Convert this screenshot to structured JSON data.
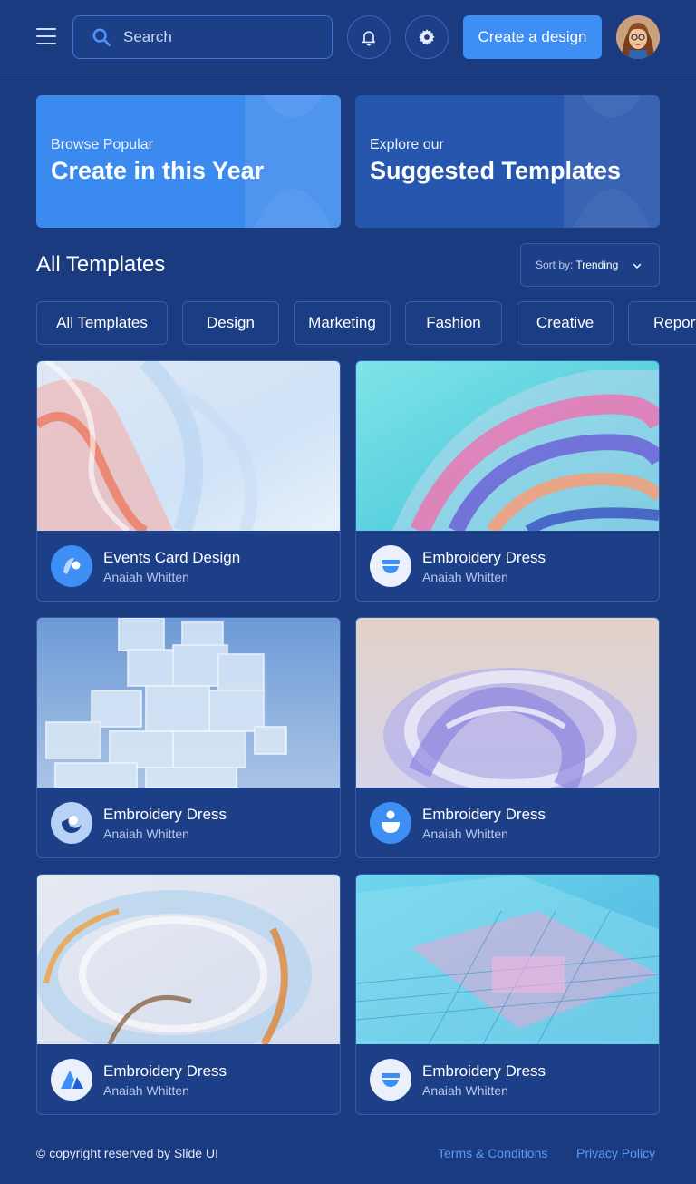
{
  "header": {
    "search_placeholder": "Search",
    "create_label": "Create a design",
    "icons": [
      "menu-icon",
      "search-icon",
      "bell-icon",
      "gear-icon"
    ]
  },
  "hero": [
    {
      "kicker": "Browse Popular",
      "title": "Create in this Year"
    },
    {
      "kicker": "Explore our",
      "title": "Suggested Templates"
    }
  ],
  "section": {
    "title": "All Templates",
    "sort_label": "Sort by:",
    "sort_value": "Trending"
  },
  "chips": [
    "All Templates",
    "Design",
    "Marketing",
    "Fashion",
    "Creative",
    "Report"
  ],
  "cards": [
    {
      "name": "Events Card Design",
      "author": "Anaiah Whitten"
    },
    {
      "name": "Embroidery Dress",
      "author": "Anaiah Whitten"
    },
    {
      "name": "Embroidery Dress",
      "author": "Anaiah Whitten"
    },
    {
      "name": "Embroidery Dress",
      "author": "Anaiah Whitten"
    },
    {
      "name": "Embroidery Dress",
      "author": "Anaiah Whitten"
    },
    {
      "name": "Embroidery Dress",
      "author": "Anaiah Whitten"
    }
  ],
  "footer": {
    "copyright": "© copyright reserved by Slide UI",
    "terms": "Terms & Conditions",
    "privacy": "Privacy Policy"
  },
  "colors": {
    "background": "#1a3b7f",
    "accent": "#3d8ef5",
    "link": "#5b9bf5"
  }
}
